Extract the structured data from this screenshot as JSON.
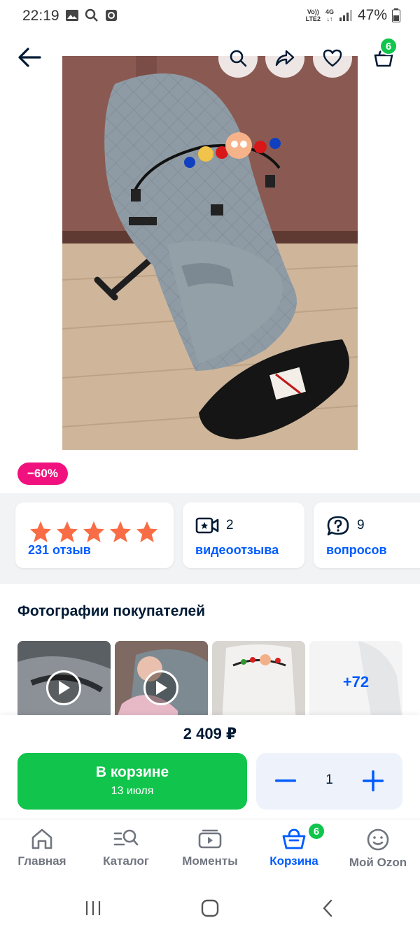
{
  "status_bar": {
    "time": "22:19",
    "network_line1": "Vo))",
    "network_line2": "LTE2",
    "network_type": "4G",
    "battery": "47%"
  },
  "header": {
    "back_icon": "arrow-left-icon",
    "search_icon": "search-icon",
    "share_icon": "share-icon",
    "favorite_icon": "heart-icon",
    "cart_icon": "basket-icon",
    "cart_badge": "6"
  },
  "product": {
    "discount": "−60%"
  },
  "stats": {
    "reviews": {
      "rating": 5,
      "label": "231 отзыв"
    },
    "videos": {
      "count": "2",
      "label": "видеоотзыва"
    },
    "questions": {
      "count": "9",
      "label": "вопросов"
    }
  },
  "photos": {
    "title": "Фотографии покупателей",
    "more_label": "+72"
  },
  "buy": {
    "price": "2 409 ₽",
    "cart_button": "В корзине",
    "delivery_date": "13 июля",
    "quantity": "1"
  },
  "bottom_nav": {
    "items": [
      {
        "label": "Главная",
        "icon": "home-icon"
      },
      {
        "label": "Каталог",
        "icon": "catalog-search-icon"
      },
      {
        "label": "Моменты",
        "icon": "moments-play-icon"
      },
      {
        "label": "Корзина",
        "icon": "basket-icon",
        "badge": "6",
        "active": true
      },
      {
        "label": "Мой Ozon",
        "icon": "profile-smile-icon"
      }
    ]
  },
  "colors": {
    "accent_blue": "#005bff",
    "green": "#10c44c",
    "discount_pink": "#f1117e",
    "star_orange": "#f86d45"
  }
}
